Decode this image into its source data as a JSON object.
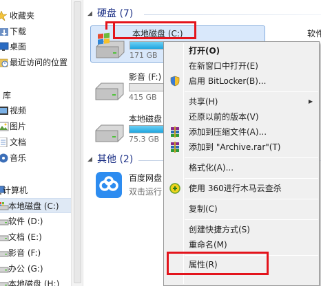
{
  "nav": {
    "favorites_label": "收藏夹",
    "favorites": [
      {
        "label": "下载",
        "icon": "download-folder-icon"
      },
      {
        "label": "桌面",
        "icon": "desktop-icon"
      },
      {
        "label": "最近访问的位置",
        "icon": "recent-places-icon"
      }
    ],
    "libraries_label": "库",
    "libraries": [
      {
        "label": "视频",
        "icon": "video-library-icon"
      },
      {
        "label": "图片",
        "icon": "pictures-library-icon"
      },
      {
        "label": "文档",
        "icon": "documents-library-icon"
      },
      {
        "label": "音乐",
        "icon": "music-library-icon"
      }
    ],
    "computer_label": "计算机",
    "drives": [
      {
        "label": "本地磁盘 (C:)"
      },
      {
        "label": "软件 (D:)"
      },
      {
        "label": "文档 (E:)"
      },
      {
        "label": "影音 (F:)"
      },
      {
        "label": "办公 (G:)"
      },
      {
        "label": "本地磁盘 (H:)"
      }
    ]
  },
  "content": {
    "hard_disks_header": "硬盘 (7)",
    "other_header": "其他 (2)",
    "drives": [
      {
        "name": "本地磁盘 (C:)",
        "info": "171 GB",
        "usage": 0.55
      },
      {
        "name": "影音 (F:)",
        "info": "415 GB",
        "usage": 0.0
      },
      {
        "name": "本地磁盘",
        "info": "75.3 GB",
        "usage": 0.6
      }
    ],
    "right_column_drive": "软件",
    "other_item": {
      "name": "百度网盘",
      "info": "双击运行"
    }
  },
  "context_menu": {
    "items": [
      {
        "label": "打开(O)",
        "bold": true
      },
      {
        "label": "在新窗口中打开(E)"
      },
      {
        "label": "启用 BitLocker(B)...",
        "icon": "shield-icon"
      },
      {
        "label": "共享(H)",
        "submenu": true
      },
      {
        "label": "还原以前的版本(V)"
      },
      {
        "label": "添加到压缩文件(A)...",
        "icon": "winrar-icon"
      },
      {
        "label": "添加到 \"Archive.rar\"(T)",
        "icon": "winrar-icon"
      },
      {
        "label": "格式化(A)..."
      },
      {
        "label": "使用 360进行木马云查杀",
        "icon": "360-icon"
      },
      {
        "label": "复制(C)"
      },
      {
        "label": "创建快捷方式(S)"
      },
      {
        "label": "重命名(M)"
      },
      {
        "label": "属性(R)"
      }
    ]
  },
  "colors": {
    "annotation_red": "#e3141c",
    "selection_blue": "#d9e8fb",
    "header_blue": "#1e3287",
    "bar_fill": "#1fa6e0"
  }
}
